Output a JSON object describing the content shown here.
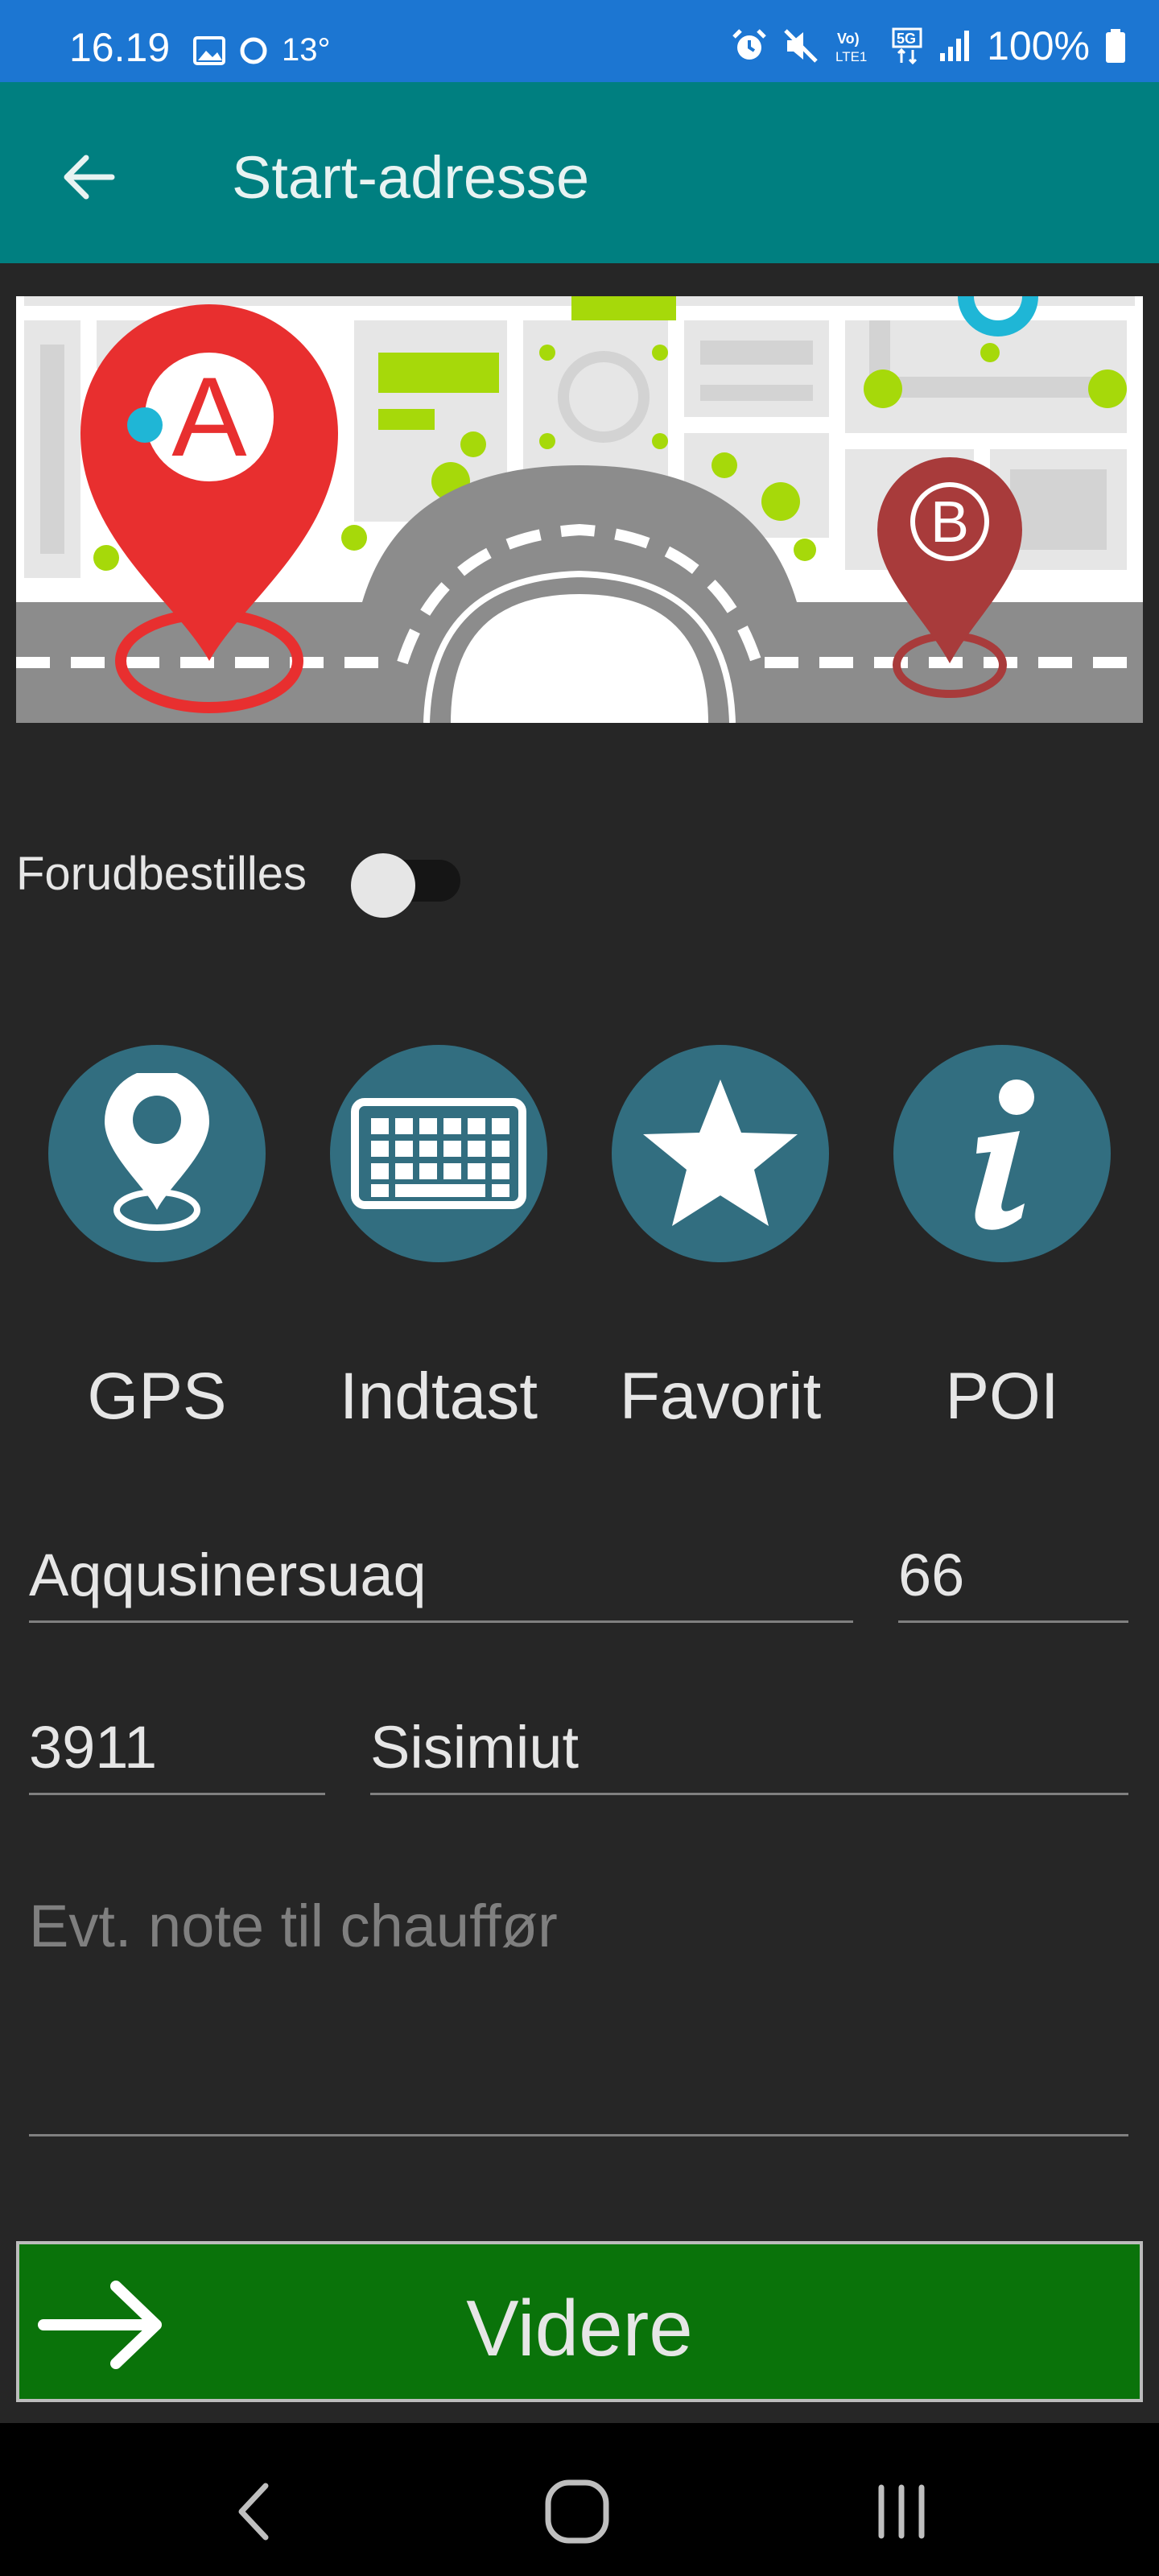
{
  "status_bar": {
    "time": "16.19",
    "temperature": "13°",
    "battery": "100%",
    "icons": [
      "image-icon",
      "circle-icon",
      "alarm-icon",
      "mute-icon",
      "volte-icon",
      "5g-icon",
      "signal-icon",
      "battery-icon"
    ]
  },
  "app_bar": {
    "title": "Start-adresse",
    "back_icon": "arrow-left-icon"
  },
  "banner": {
    "marker_a": "A",
    "marker_b": "B"
  },
  "prebook": {
    "label": "Forudbestilles",
    "enabled": false
  },
  "options": [
    {
      "label": "GPS",
      "icon": "location-pin-icon"
    },
    {
      "label": "Indtast",
      "icon": "keyboard-icon"
    },
    {
      "label": "Favorit",
      "icon": "star-icon"
    },
    {
      "label": "POI",
      "icon": "info-icon"
    }
  ],
  "address": {
    "street": "Aqqusinersuaq",
    "number": "66",
    "postcode": "3911",
    "city": "Sisimiut",
    "note_placeholder": "Evt. note til chauffør"
  },
  "continue_button": {
    "label": "Videre"
  },
  "colors": {
    "status_bar": "#1c76d2",
    "app_bar": "#007f80",
    "background": "#262626",
    "option_circle": "#326e80",
    "continue_button": "#0a730a"
  }
}
